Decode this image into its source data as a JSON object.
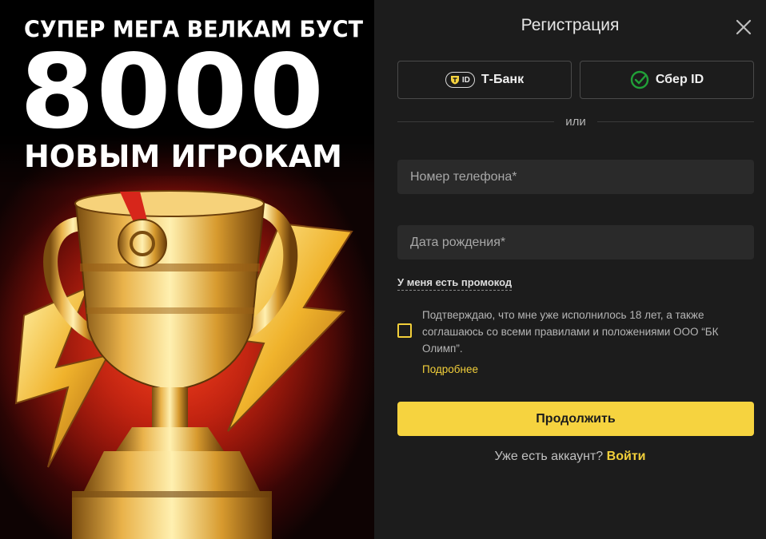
{
  "promo": {
    "line1": "СУПЕР МЕГА ВЕЛКАМ БУСТ",
    "number": "8000",
    "line2": "НОВЫМ ИГРОКАМ"
  },
  "form": {
    "title": "Регистрация",
    "sso": {
      "tbank_badge": "ID",
      "tbank_label": "Т-Банк",
      "sber_label": "Сбер ID"
    },
    "divider": "или",
    "phone_placeholder": "Номер телефона*",
    "birth_placeholder": "Дата рождения*",
    "promo_code_link": "У меня есть промокод",
    "agreement": "Подтверждаю, что мне уже исполнилось 18 лет, а также соглашаюсь со всеми правилами и положениями ООО “БК Олимп”.",
    "more_link": "Подробнее",
    "continue_label": "Продолжить",
    "login_prompt": "Уже есть аккаунт?",
    "login_link": "Войти"
  },
  "colors": {
    "accent": "#f6d33f",
    "panel_bg": "#1c1c1c",
    "field_bg": "#2a2a2a",
    "sber_green": "#21a038"
  },
  "icons": {
    "close": "close-icon",
    "tbank": "tbank-shield-icon",
    "sber": "sber-check-icon",
    "checkbox": "checkbox"
  }
}
